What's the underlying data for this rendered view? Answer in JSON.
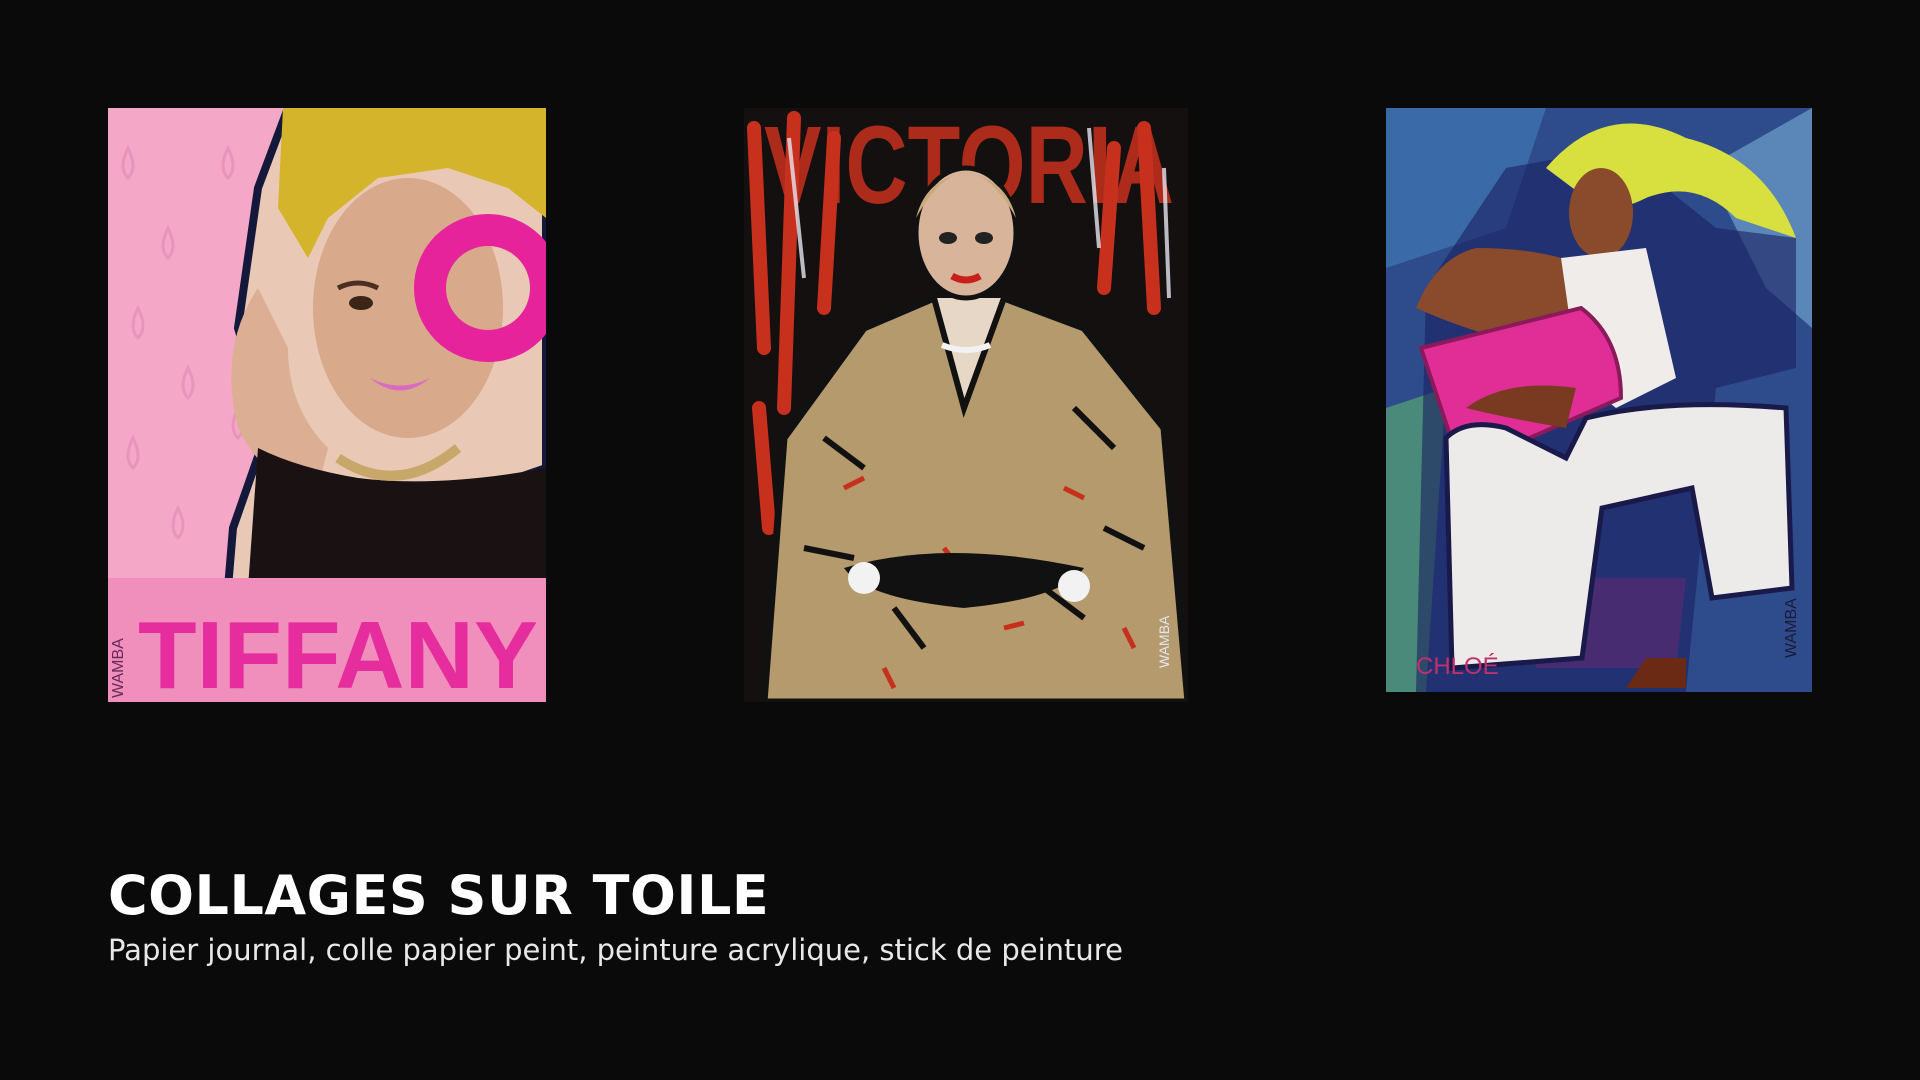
{
  "slide": {
    "title": "COLLAGES SUR TOILE",
    "subtitle": "Papier journal, colle papier peint, peinture acrylique, stick de peinture"
  },
  "artworks": [
    {
      "label": "TIFFANY",
      "signature": "WAMBA",
      "palette": {
        "background": "#f4a7c7",
        "accent": "#e6239a",
        "hair": "#d4b42a"
      }
    },
    {
      "label": "VICTORIA",
      "signature": "WAMBA",
      "palette": {
        "background": "#141010",
        "accent": "#c8301e",
        "coat": "#b49a6c"
      }
    },
    {
      "label": "CHLOÉ",
      "signature": "WAMBA",
      "palette": {
        "background": "#2e4c8c",
        "accent": "#e02e96",
        "hair": "#d8e040"
      }
    }
  ],
  "colors": {
    "page_background": "#0a0a0a",
    "title_text": "#ffffff",
    "subtitle_text": "#e8e8e8"
  }
}
